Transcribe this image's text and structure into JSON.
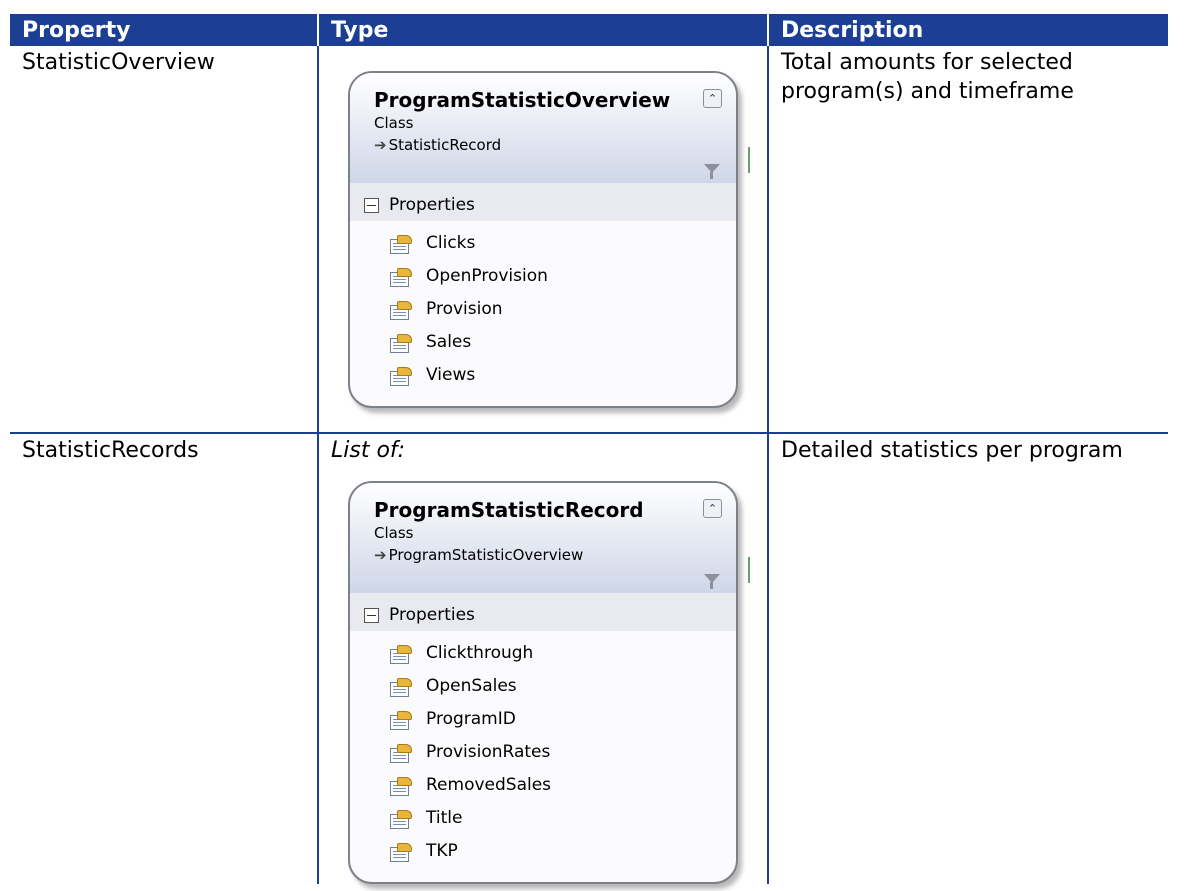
{
  "table": {
    "headers": [
      "Property",
      "Type",
      "Description"
    ],
    "rows": [
      {
        "property": "StatisticOverview",
        "type_prefix": "",
        "class_shape": {
          "name": "ProgramStatisticOverview",
          "kind": "Class",
          "inherits": "StatisticRecord",
          "compartment": "Properties",
          "properties": [
            "Clicks",
            "OpenProvision",
            "Provision",
            "Sales",
            "Views"
          ]
        },
        "description": "Total amounts for selected program(s) and timeframe"
      },
      {
        "property": "StatisticRecords",
        "type_prefix": "List of:",
        "class_shape": {
          "name": "ProgramStatisticRecord",
          "kind": "Class",
          "inherits": "ProgramStatisticOverview",
          "compartment": "Properties",
          "properties": [
            "Clickthrough",
            "OpenSales",
            "ProgramID",
            "ProvisionRates",
            "RemovedSales",
            "Title",
            "TKP"
          ]
        },
        "description": "Detailed statistics per program"
      }
    ]
  },
  "icons": {
    "collapse": "double-chevron-up-icon",
    "filter": "filter-icon",
    "inherit_arrow": "arrow-right-icon",
    "compartment_toggle": "minus-box-icon",
    "property": "property-icon"
  },
  "colors": {
    "header_bg": "#1c3f94",
    "header_text": "#ffffff",
    "border": "#1c3f94"
  }
}
